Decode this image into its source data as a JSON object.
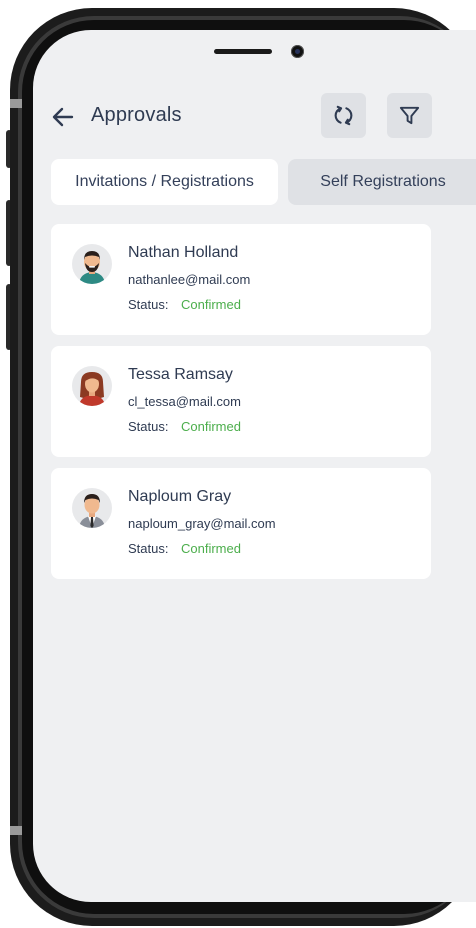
{
  "header": {
    "title": "Approvals",
    "back_icon": "arrow-left-icon",
    "refresh_icon": "refresh-icon",
    "filter_icon": "filter-icon"
  },
  "tabs": [
    {
      "label": "Invitations / Registrations",
      "active": true
    },
    {
      "label": "Self Registrations",
      "active": false
    }
  ],
  "approvals": [
    {
      "name": "Nathan Holland",
      "email": "nathanlee@mail.com",
      "status_label": "Status:",
      "status": "Confirmed"
    },
    {
      "name": "Tessa Ramsay",
      "email": "cl_tessa@mail.com",
      "status_label": "Status:",
      "status": "Confirmed"
    },
    {
      "name": "Naploum Gray",
      "email": "naploum_gray@mail.com",
      "status_label": "Status:",
      "status": "Confirmed"
    }
  ],
  "colors": {
    "background": "#eff0f2",
    "card": "#ffffff",
    "text": "#2f3b52",
    "status_confirmed": "#4cae4c"
  }
}
